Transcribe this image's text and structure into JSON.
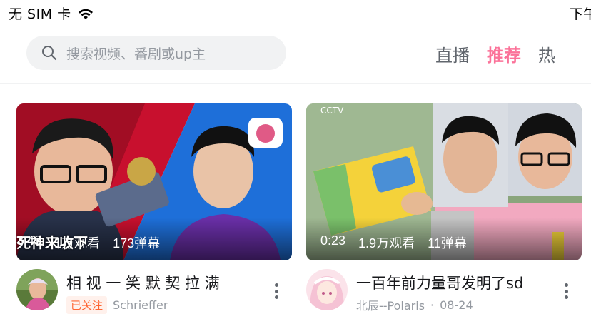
{
  "status_bar": {
    "carrier": "无 SIM 卡",
    "time": "下午"
  },
  "header": {
    "search_placeholder": "搜索视频、番剧或up主",
    "tabs": [
      {
        "label": "直播",
        "active": false
      },
      {
        "label": "推荐",
        "active": true
      },
      {
        "label": "热",
        "active": false
      }
    ],
    "accent_color": "#fb7299"
  },
  "feed": [
    {
      "duration": "3:43",
      "views": "1万观看",
      "danmaku": "173弹幕",
      "overlay_text": "死神来收下",
      "title": "相 视 一 笑   默 契 拉 满",
      "follow_badge": "已关注",
      "author": "Schrieffer",
      "date": ""
    },
    {
      "duration": "0:23",
      "views": "1.9万观看",
      "danmaku": "11弹幕",
      "overlay_text": "",
      "title": "一百年前力量哥发明了sd",
      "follow_badge": "",
      "author": "北辰--Polaris",
      "date": "08-24"
    }
  ]
}
